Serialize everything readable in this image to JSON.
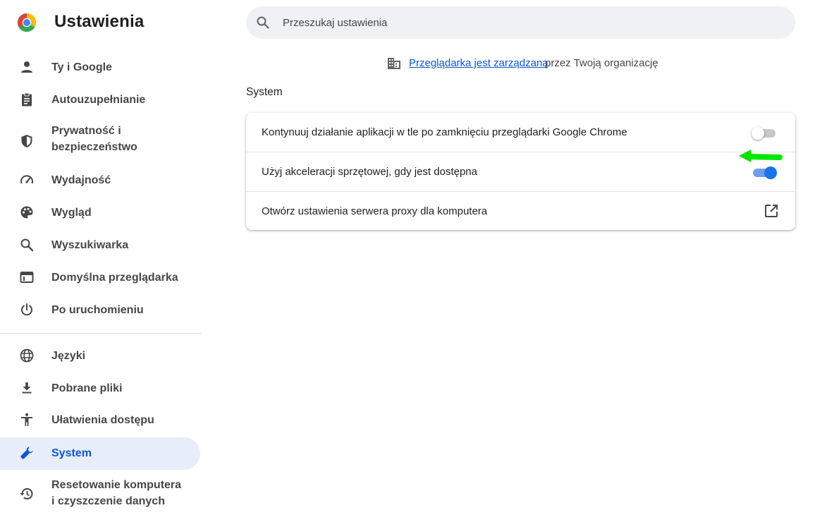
{
  "header": {
    "title": "Ustawienia",
    "logo_icon": "chrome-logo",
    "search_placeholder": "Przeszukaj ustawienia"
  },
  "sidebar": {
    "items": [
      {
        "label": "Ty i Google",
        "icon": "person-icon"
      },
      {
        "label": "Autouzupełnianie",
        "icon": "clipboard-icon"
      },
      {
        "label": "Prywatność i",
        "label2": "bezpieczeństwo",
        "icon": "shield-icon"
      },
      {
        "label": "Wydajność",
        "icon": "speedometer-icon"
      },
      {
        "label": "Wygląd",
        "icon": "palette-icon"
      },
      {
        "label": "Wyszukiwarka",
        "icon": "search-icon"
      },
      {
        "label": "Domyślna przeglądarka",
        "icon": "browser-window-icon"
      },
      {
        "label": "Po uruchomieniu",
        "icon": "power-icon"
      },
      {
        "label": "Języki",
        "icon": "globe-icon"
      },
      {
        "label": "Pobrane pliki",
        "icon": "download-icon"
      },
      {
        "label": "Ułatwienia dostępu",
        "icon": "accessibility-icon"
      },
      {
        "label": "System",
        "icon": "wrench-icon",
        "active": true
      },
      {
        "label": "Resetowanie komputera",
        "label2": "i czyszczenie danych",
        "icon": "restore-icon"
      }
    ]
  },
  "main": {
    "managed": {
      "link": "Przeglądarka jest zarządzana",
      "rest": "przez Twoją organizację"
    },
    "section_title": "System",
    "rows": [
      {
        "label": "Kontynuuj działanie aplikacji w tle po zamknięciu przeglądarki Google Chrome",
        "control": "toggle",
        "enabled": false
      },
      {
        "label": "Użyj akceleracji sprzętowej, gdy jest dostępna",
        "control": "toggle",
        "enabled": true
      },
      {
        "label": "Otwórz ustawienia serwera proxy dla komputera",
        "control": "external-link"
      }
    ]
  },
  "colors": {
    "accent": "#0b57d0",
    "toggle_on": "#1a73e8",
    "active_nav_bg": "#e8edfa",
    "annotation_arrow": "#00e600"
  }
}
